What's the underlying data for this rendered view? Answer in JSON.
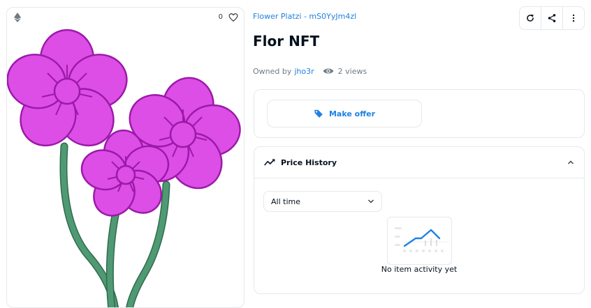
{
  "asset": {
    "favorite_count": "0",
    "icons": {
      "chain": "ethereum-icon",
      "favorite": "heart-icon"
    },
    "image_name": "flower-illustration"
  },
  "collection": {
    "name": "Flower Platzi - mS0YyJm4zl"
  },
  "toolbar": {
    "icons": [
      "refresh-icon",
      "share-icon",
      "more-icon"
    ]
  },
  "item": {
    "title": "Flor NFT",
    "owned_by_label": "Owned by",
    "owner": "jho3r",
    "views": "2 views"
  },
  "offer": {
    "button_label": "Make offer"
  },
  "price_history": {
    "title": "Price History",
    "filter_value": "All time",
    "empty_message": "No item activity yet"
  },
  "colors": {
    "accent": "#2081e2",
    "petal": "#dd4ee6",
    "petal_outline": "#9b1aa8",
    "stem": "#4f9a72",
    "border": "#e5e8eb"
  }
}
